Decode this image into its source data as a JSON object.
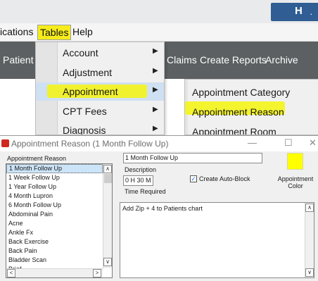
{
  "title_button": {
    "glyph": "H",
    "sub": "."
  },
  "menubar": {
    "items": [
      "ications",
      "Tables",
      "Help"
    ]
  },
  "toolbar": {
    "items": [
      "Patient H",
      "Claims",
      "Create Reports",
      "Archive"
    ]
  },
  "tables_menu": {
    "items": [
      {
        "label": "Account",
        "arrow": "▶"
      },
      {
        "label": "Adjustment",
        "arrow": "▶"
      },
      {
        "label": "Appointment",
        "arrow": "▶"
      },
      {
        "label": "CPT Fees",
        "arrow": "▶"
      },
      {
        "label": "Diagnosis",
        "arrow": "▶"
      }
    ]
  },
  "appointment_submenu": {
    "items": [
      "Appointment Category",
      "Appointment Reason",
      "Appointment Room"
    ]
  },
  "dialog": {
    "title": "Appointment Reason (1 Month Follow Up)",
    "controls": {
      "minimize": "—",
      "maximize": "☐",
      "close": "✕"
    },
    "list_label": "Appointment Reason",
    "reasons": [
      "1 Month Follow Up",
      "1 Week Follow Up",
      "1 Year Follow Up",
      "4 Month Lupron",
      "6 Month Follow Up",
      "Abdominal Pain",
      "Acne",
      "Ankle Fx",
      "Back Exercise",
      "Back Pain",
      "Bladder Scan",
      "Brief"
    ],
    "selected_reason": "1 Month Follow Up",
    "name_value": "1 Month Follow Up",
    "description_label": "Description",
    "time_value": "0 H 30 M",
    "time_label": "Time Required",
    "auto_block_label": "Create Auto-Block",
    "auto_block_checked": true,
    "check_glyph": "✓",
    "color_label": "Appointment Color",
    "color_hex": "#ffff00",
    "notes_text": "Add Zip + 4 to Patients chart",
    "scroll_up": "∧",
    "scroll_down": "∨",
    "scroll_left": "<",
    "scroll_right": ">"
  },
  "colors": {
    "toolbar": "#5c6062",
    "highlight": "#f6ec1c",
    "title_button": "#2f5d94"
  }
}
